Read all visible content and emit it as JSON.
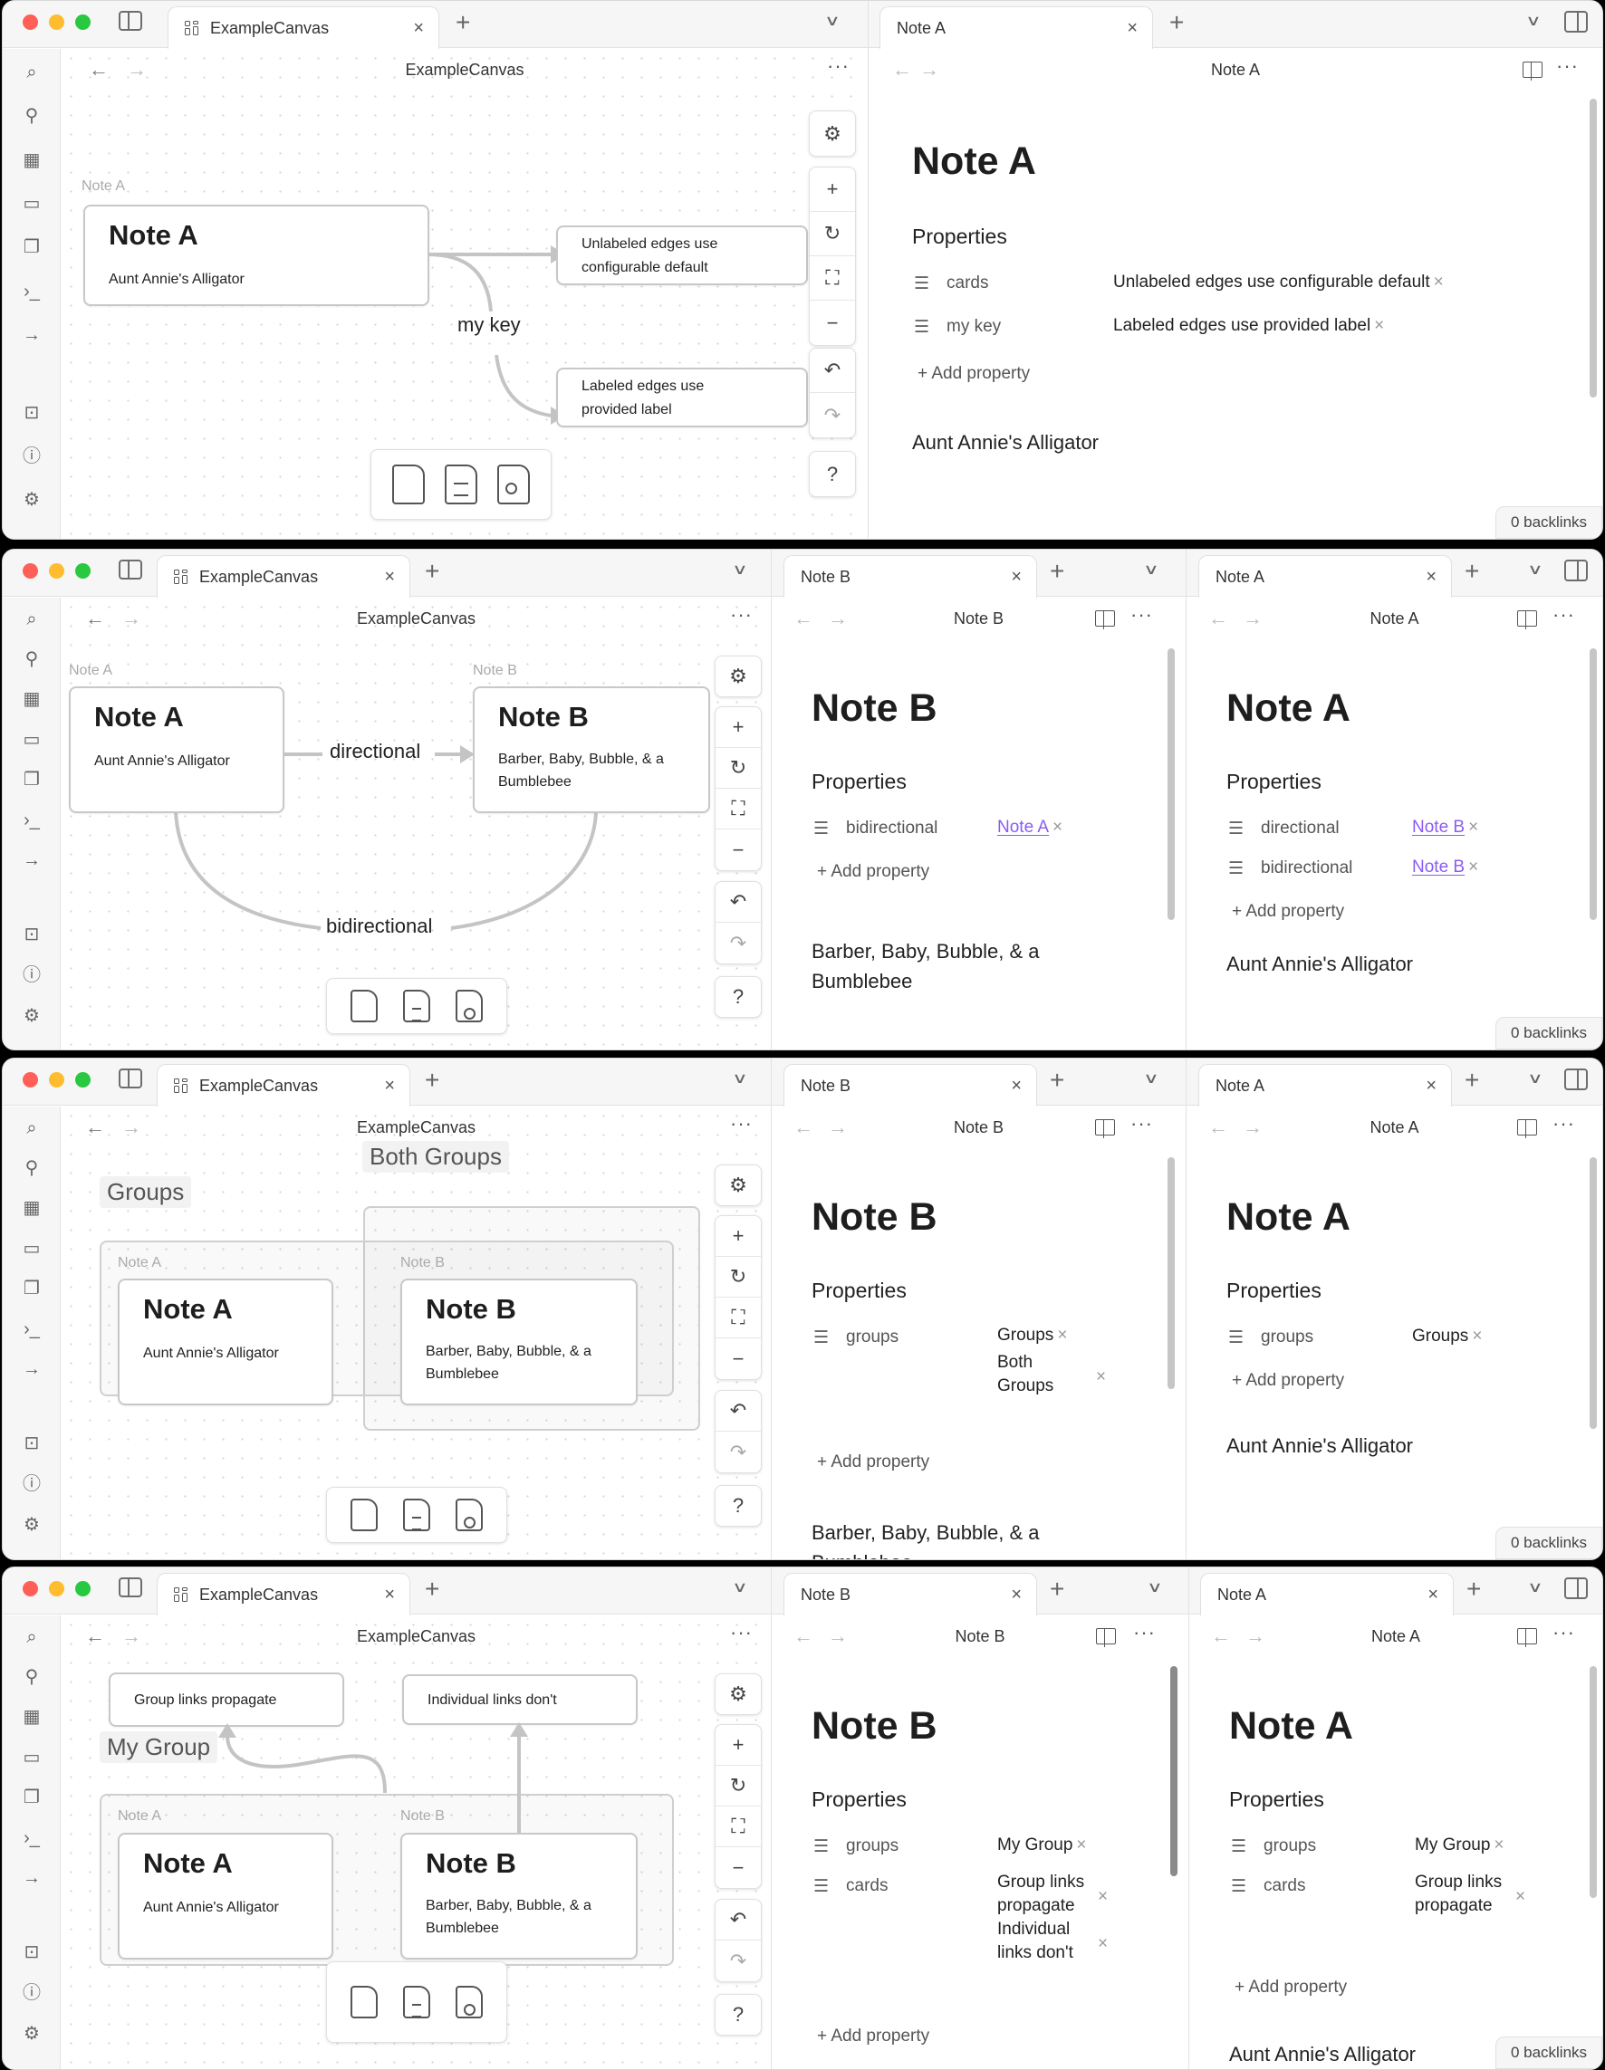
{
  "window": {
    "canvas_tab_label": "ExampleCanvas",
    "canvas_header_title": "ExampleCanvas",
    "new_tab_symbol": "+",
    "close_symbol": "×",
    "chevron_symbol": "∨",
    "more_symbol": "···",
    "back_symbol": "←",
    "forward_symbol": "→",
    "traffic_lights": {
      "close": "#fe5f57",
      "minimize": "#febc2e",
      "zoom": "#28c840"
    }
  },
  "ribbon": {
    "icons": [
      "quick-switcher-icon",
      "graph-view-icon",
      "canvas-icon",
      "daily-note-icon",
      "templates-icon",
      "command-palette-icon",
      "go-to-icon"
    ],
    "bottom_icons": [
      "vault-icon",
      "help-icon",
      "settings-icon"
    ]
  },
  "canvas_controls": [
    "settings",
    "zoom-in",
    "reset-zoom",
    "fit",
    "zoom-out",
    "undo",
    "redo",
    "help"
  ],
  "colors": {
    "link": "#8a5cf5",
    "edge": "#c4c4c4",
    "card_border": "#c8c8c8"
  },
  "panels": [
    {
      "canvas": {
        "cards": [
          {
            "label": "Note A",
            "title": "Note A",
            "text": "Aunt Annie's Alligator"
          },
          {
            "text_lines": [
              "Unlabeled edges use",
              "configurable default"
            ]
          },
          {
            "text_lines": [
              "Labeled edges use",
              "provided label"
            ]
          }
        ],
        "edge_labels": [
          "my key"
        ]
      },
      "notes": [
        {
          "tab_label": "Note A",
          "header_title": "Note A",
          "title": "Note A",
          "properties_title": "Properties",
          "properties": [
            {
              "key": "cards",
              "values": [
                "Unlabeled edges use configurable default"
              ]
            },
            {
              "key": "my key",
              "values": [
                "Labeled edges use provided label"
              ]
            }
          ],
          "add_property": "Add property",
          "body": "Aunt Annie's Alligator",
          "backlinks": "0 backlinks"
        }
      ]
    },
    {
      "canvas": {
        "cards": [
          {
            "label": "Note A",
            "title": "Note A",
            "text": "Aunt Annie's Alligator"
          },
          {
            "label": "Note B",
            "title": "Note B",
            "text_lines": [
              "Barber, Baby, Bubble, & a",
              "Bumblebee"
            ]
          }
        ],
        "edge_labels": [
          "directional",
          "bidirectional"
        ]
      },
      "notes": [
        {
          "tab_label": "Note B",
          "header_title": "Note B",
          "title": "Note B",
          "properties_title": "Properties",
          "properties": [
            {
              "key": "bidirectional",
              "values": [
                "Note A"
              ],
              "link": true
            }
          ],
          "add_property": "Add property",
          "body_lines": [
            "Barber, Baby, Bubble, & a",
            "Bumblebee"
          ]
        },
        {
          "tab_label": "Note A",
          "header_title": "Note A",
          "title": "Note A",
          "properties_title": "Properties",
          "properties": [
            {
              "key": "directional",
              "values": [
                "Note B"
              ],
              "link": true
            },
            {
              "key": "bidirectional",
              "values": [
                "Note B"
              ],
              "link": true
            }
          ],
          "add_property": "Add property",
          "body": "Aunt Annie's Alligator",
          "backlinks": "0 backlinks"
        }
      ]
    },
    {
      "canvas": {
        "groups": [
          "Groups",
          "Both Groups"
        ],
        "cards": [
          {
            "label": "Note A",
            "title": "Note A",
            "text": "Aunt Annie's Alligator"
          },
          {
            "label": "Note B",
            "title": "Note B",
            "text_lines": [
              "Barber, Baby, Bubble, & a",
              "Bumblebee"
            ]
          }
        ]
      },
      "notes": [
        {
          "tab_label": "Note B",
          "header_title": "Note B",
          "title": "Note B",
          "properties_title": "Properties",
          "properties": [
            {
              "key": "groups",
              "values": [
                "Groups",
                "Both Groups"
              ]
            }
          ],
          "value_lines": [
            "Groups",
            "Both",
            "Groups"
          ],
          "add_property": "Add property",
          "body_lines": [
            "Barber, Baby, Bubble, & a",
            "Bumblebee"
          ]
        },
        {
          "tab_label": "Note A",
          "header_title": "Note A",
          "title": "Note A",
          "properties_title": "Properties",
          "properties": [
            {
              "key": "groups",
              "values": [
                "Groups"
              ]
            }
          ],
          "add_property": "Add property",
          "body": "Aunt Annie's Alligator",
          "backlinks": "0 backlinks"
        }
      ]
    },
    {
      "canvas": {
        "groups": [
          "My Group"
        ],
        "cards": [
          {
            "text": "Group links propagate"
          },
          {
            "text": "Individual links don't"
          },
          {
            "label": "Note A",
            "title": "Note A",
            "text": "Aunt Annie's Alligator"
          },
          {
            "label": "Note B",
            "title": "Note B",
            "text_lines": [
              "Barber, Baby, Bubble, & a",
              "Bumblebee"
            ]
          }
        ]
      },
      "notes": [
        {
          "tab_label": "Note B",
          "header_title": "Note B",
          "title": "Note B",
          "properties_title": "Properties",
          "properties": [
            {
              "key": "groups",
              "values": [
                "My Group"
              ]
            },
            {
              "key": "cards",
              "values": [
                "Group links propagate",
                "Individual links don't"
              ]
            }
          ],
          "value_lines": {
            "card1": [
              "Group links",
              "propagate"
            ],
            "card2": [
              "Individual",
              "links don't"
            ]
          },
          "add_property": "Add property"
        },
        {
          "tab_label": "Note A",
          "header_title": "Note A",
          "title": "Note A",
          "properties_title": "Properties",
          "properties": [
            {
              "key": "groups",
              "values": [
                "My Group"
              ]
            },
            {
              "key": "cards",
              "values": [
                "Group links propagate"
              ]
            }
          ],
          "value_lines": {
            "card1": [
              "Group links",
              "propagate"
            ]
          },
          "add_property": "Add property",
          "body": "Aunt Annie's Alligator",
          "backlinks": "0 backlinks"
        }
      ]
    }
  ]
}
